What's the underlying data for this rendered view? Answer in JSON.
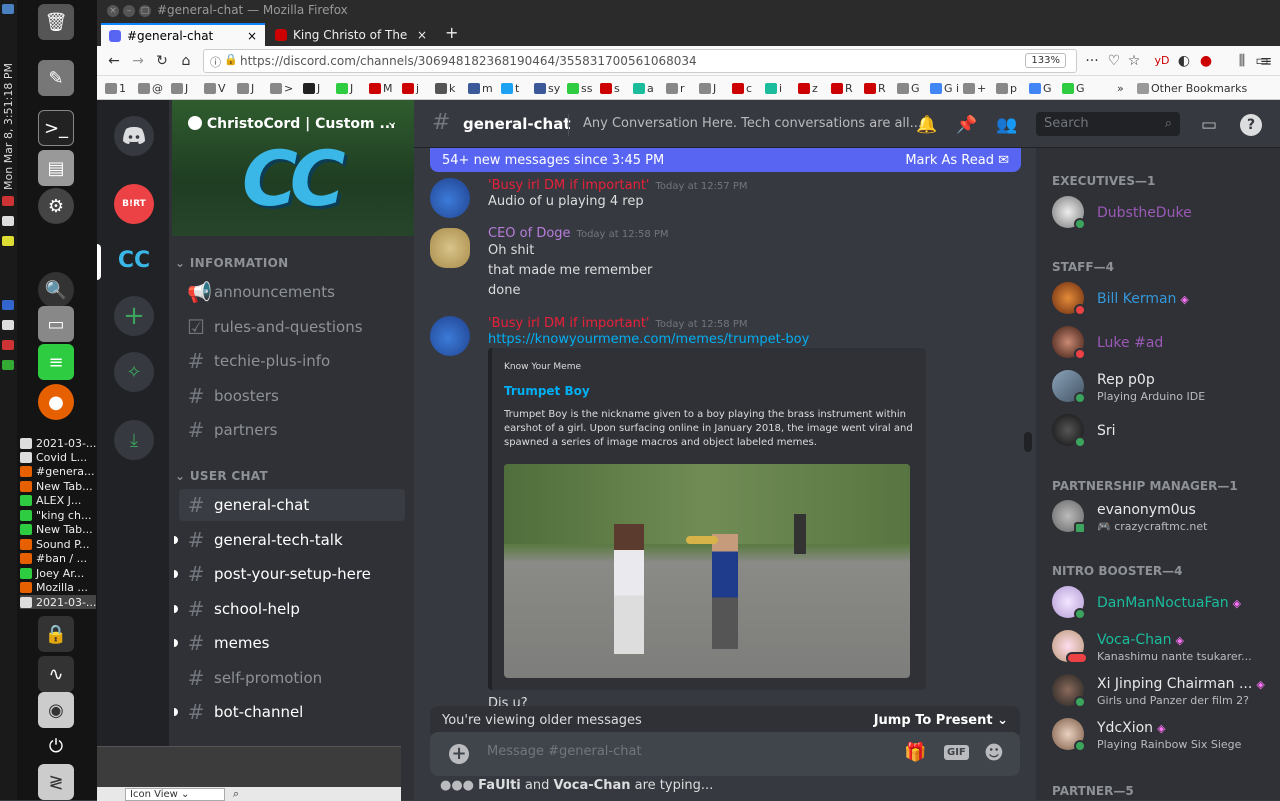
{
  "desktop": {
    "clock": "Mon Mar 8, 3:51:18 PM",
    "windows": [
      "2021-03-...",
      "Covid L...",
      "#genera...",
      "New Tab...",
      "ALEX J...",
      "\"king ch...",
      "New Tab...",
      "Sound P...",
      "#ban / ...",
      "Joey Ar...",
      "Mozilla ...",
      "2021-03-..."
    ]
  },
  "browser": {
    "window_title": "#general-chat — Mozilla Firefox",
    "tabs": [
      {
        "label": "#general-chat"
      },
      {
        "label": "King Christo of The Chri"
      }
    ],
    "url": "https://discord.com/channels/306948182368190464/355831700561068034",
    "zoom": "133%",
    "bookmarks": [
      "1",
      "@",
      "J",
      "V",
      "J",
      ">",
      "J",
      "J",
      "M",
      "j",
      "k",
      "m",
      "t",
      "sy",
      "ss",
      "s",
      "a",
      "r",
      "J",
      "c",
      "i",
      "z",
      "R",
      "R",
      "G",
      "G i",
      "+",
      "p",
      "G",
      "G"
    ],
    "other_bookmarks": "Other Bookmarks"
  },
  "server": {
    "name": "ChristoCord | Custom ...",
    "banner_text": "CC",
    "categories": [
      {
        "label": "INFORMATION",
        "channels": [
          {
            "name": "announcements",
            "icon": "megaphone-icon"
          },
          {
            "name": "rules-and-questions",
            "icon": "checkbox-icon"
          },
          {
            "name": "techie-plus-info",
            "icon": "#"
          },
          {
            "name": "boosters",
            "icon": "#"
          },
          {
            "name": "partners",
            "icon": "#"
          }
        ]
      },
      {
        "label": "USER CHAT",
        "channels": [
          {
            "name": "general-chat",
            "icon": "#"
          },
          {
            "name": "general-tech-talk",
            "icon": "#"
          },
          {
            "name": "post-your-setup-here",
            "icon": "#"
          },
          {
            "name": "school-help",
            "icon": "#"
          },
          {
            "name": "memes",
            "icon": "#"
          },
          {
            "name": "self-promotion",
            "icon": "#"
          },
          {
            "name": "bot-channel",
            "icon": "#"
          }
        ]
      }
    ]
  },
  "header": {
    "channel": "general-chat",
    "topic": "Any Conversation Here. Tech conversations are all...",
    "search_placeholder": "Search"
  },
  "chat": {
    "new_messages": "54+ new messages since 3:45 PM",
    "mark_read": "Mark As Read",
    "messages": [
      {
        "author": "'Busy irl DM if important'",
        "time": "Today at 12:57 PM",
        "lines": [
          "Audio of u playing 4 rep"
        ],
        "color": "#e8203a"
      },
      {
        "author": "CEO of Doge",
        "time": "Today at 12:58 PM",
        "lines": [
          "Oh shit",
          "that made me remember",
          "done"
        ],
        "color": "#b77edb"
      },
      {
        "author": "'Busy irl DM if important'",
        "time": "Today at 12:58 PM",
        "lines": [
          "https://knowyourmeme.com/memes/trumpet-boy"
        ],
        "color": "#e8203a"
      }
    ],
    "embed": {
      "provider": "Know Your Meme",
      "title": "Trumpet Boy",
      "description": "Trumpet Boy is the nickname given to a boy playing the brass instrument within earshot of a girl. Upon surfacing online in January 2018, the image went viral and spawned a series of image macros and object labeled memes."
    },
    "after_embed": "Dis u?",
    "older_notice": "You're viewing older messages",
    "jump_present": "Jump To Present",
    "composer_placeholder": "Message #general-chat",
    "typing_user1": "FaUlti",
    "typing_and": "and",
    "typing_user2": "Voca-Chan",
    "typing_suffix": "are typing..."
  },
  "members": {
    "groups": [
      {
        "label": "EXECUTIVES—1",
        "members": [
          {
            "name": "DubstheDuke",
            "status": "",
            "color": "#9b59b6"
          }
        ]
      },
      {
        "label": "STAFF—4",
        "members": [
          {
            "name": "Bill Kerman",
            "status": "",
            "color": "#3498db"
          },
          {
            "name": "Luke #ad",
            "status": "",
            "color": "#9b59b6"
          },
          {
            "name": "Rep p0p",
            "status": "Playing Arduino IDE",
            "color": "#e8e8e8"
          },
          {
            "name": "Sri",
            "status": "",
            "color": "#e8e8e8"
          }
        ]
      },
      {
        "label": "PARTNERSHIP MANAGER—1",
        "members": [
          {
            "name": "evanonym0us",
            "status": "crazycraftmc.net",
            "color": "#e8e8e8"
          }
        ]
      },
      {
        "label": "NITRO BOOSTER—4",
        "members": [
          {
            "name": "DanManNoctuaFan",
            "status": "",
            "color": "#1abc9c"
          },
          {
            "name": "Voca-Chan",
            "status": "Kanashimu nante tsukarer...",
            "color": "#1abc9c"
          },
          {
            "name": "Xi Jinping Chairman ...",
            "status": "Girls und Panzer der film 2?",
            "color": "#e8e8e8"
          },
          {
            "name": "YdcXion",
            "status": "Playing Rainbow Six Siege",
            "color": "#e8e8e8"
          }
        ]
      },
      {
        "label": "PARTNER—5",
        "members": []
      }
    ]
  },
  "file_manager": {
    "view_label": "Icon View"
  }
}
